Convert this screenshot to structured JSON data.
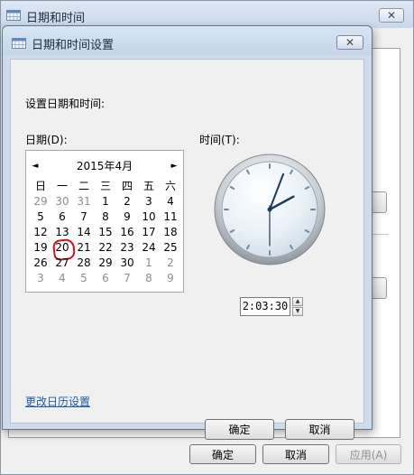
{
  "outer_window": {
    "title": "日期和时间",
    "close_glyph": "✕",
    "buttons": {
      "ok": "确定",
      "cancel": "取消",
      "apply": "应用(A)"
    }
  },
  "dialog": {
    "title": "日期和时间设置",
    "close_glyph": "✕",
    "heading": "设置日期和时间:",
    "date_label": "日期(D):",
    "time_label": "时间(T):",
    "calendar": {
      "month_title": "2015年4月",
      "prev_glyph": "◄",
      "next_glyph": "►",
      "weekdays": [
        "日",
        "一",
        "二",
        "三",
        "四",
        "五",
        "六"
      ],
      "weeks": [
        [
          "29",
          "30",
          "31",
          "1",
          "2",
          "3",
          "4"
        ],
        [
          "5",
          "6",
          "7",
          "8",
          "9",
          "10",
          "11"
        ],
        [
          "12",
          "13",
          "14",
          "15",
          "16",
          "17",
          "18"
        ],
        [
          "19",
          "20",
          "21",
          "22",
          "23",
          "24",
          "25"
        ],
        [
          "26",
          "27",
          "28",
          "29",
          "30",
          "1",
          "2"
        ],
        [
          "3",
          "4",
          "5",
          "6",
          "7",
          "8",
          "9"
        ]
      ],
      "selected_day": "20"
    },
    "time_value": "2:03:30",
    "spin_up_glyph": "▲",
    "spin_down_glyph": "▼",
    "change_calendar_link": "更改日历设置",
    "buttons": {
      "ok": "确定",
      "cancel": "取消"
    }
  },
  "clock": {
    "hour": 2,
    "minute": 3,
    "second": 30
  },
  "colors": {
    "selection_mark": "#d0121b",
    "link": "#1e5aa8",
    "title_bar": "#c9d8ea"
  }
}
